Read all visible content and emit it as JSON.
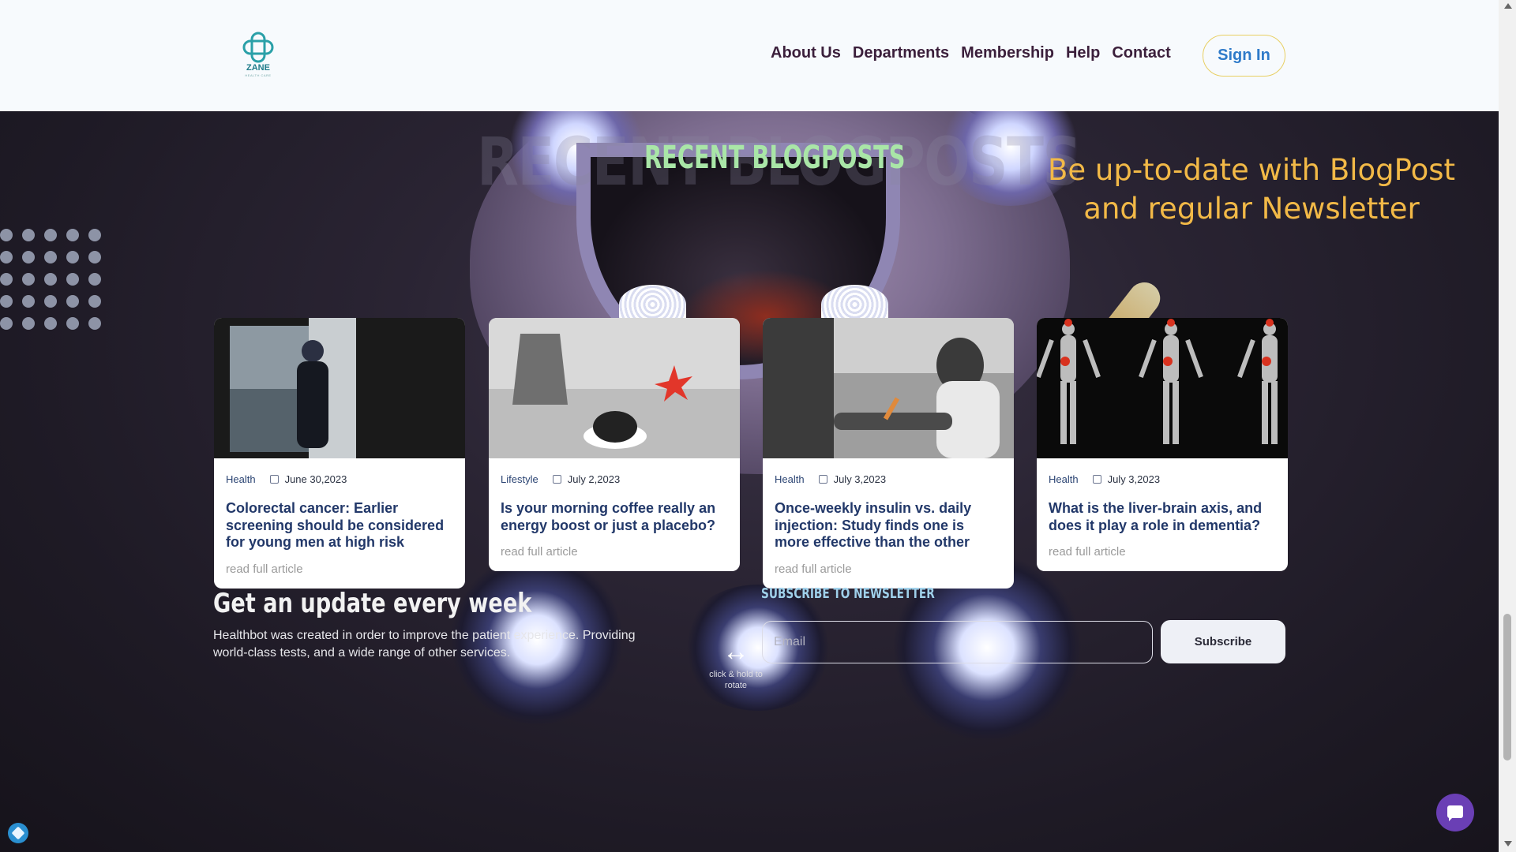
{
  "header": {
    "logo_text": "ZANE",
    "logo_sub": "HEALTH CARE",
    "nav": [
      "About Us",
      "Departments",
      "Membership",
      "Help",
      "Contact"
    ],
    "signin_label": "Sign In"
  },
  "section": {
    "ghost_title": "RECENT BLOGPOSTS",
    "title": "RECENT BLOGPOSTS",
    "promo": "Be up-to-date with BlogPost and regular Newsletter"
  },
  "cards": [
    {
      "category": "Health",
      "date": "June 30,2023",
      "title": "Colorectal cancer: Earlier screening should be considered for young men at high risk",
      "link": "read full article"
    },
    {
      "category": "Lifestyle",
      "date": "July 2,2023",
      "title": "Is your morning coffee really an energy boost or just a placebo?",
      "link": "read full article"
    },
    {
      "category": "Health",
      "date": "July 3,2023",
      "title": "Once-weekly insulin vs. daily injection: Study finds one is more effective than the other",
      "link": "read full article"
    },
    {
      "category": "Health",
      "date": "July 3,2023",
      "title": "What is the liver-brain axis, and does it play a role in dementia?",
      "link": "read full article"
    }
  ],
  "newsletter": {
    "title": "Get an update every week",
    "text": "Healthbot was created in order to improve the patient experience. Providing world-class tests, and a wide range of other services.",
    "label": "SUBSCRIBE TO NEWSLETTER",
    "email_placeholder": "Email",
    "button": "Subscribe"
  },
  "rotate_hint": {
    "icon": "pointing-hand-icon",
    "text": "click & hold to rotate"
  },
  "icons": {
    "chat": "chat-bubble-icon",
    "badge": "cube-icon",
    "calendar": "calendar-icon"
  },
  "colors": {
    "accent_title": "#a9e6a7",
    "promo": "#f2b947",
    "nav_text": "#3b1f3b",
    "signin_text": "#2e7ac9",
    "chat": "#6a3fb5"
  }
}
